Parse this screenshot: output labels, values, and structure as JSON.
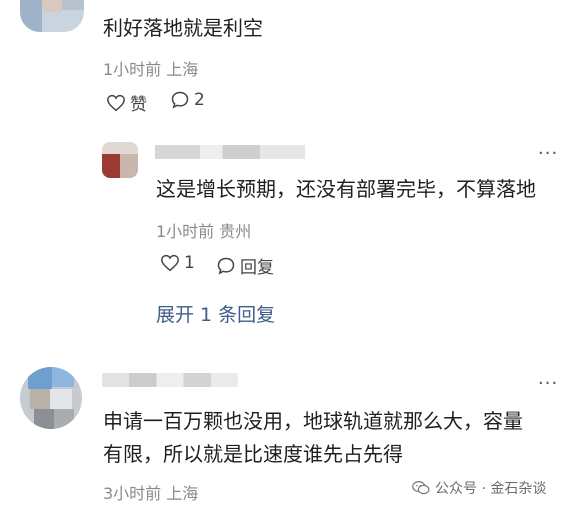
{
  "comments": [
    {
      "text": "利好落地就是利空",
      "meta": "1小时前 上海",
      "like_label": "赞",
      "reply_count": "2"
    },
    {
      "text": "这是增长预期，还没有部署完毕，不算落地",
      "meta": "1小时前 贵州",
      "like_count": "1",
      "reply_label": "回复",
      "expand_label": "展开 1 条回复"
    },
    {
      "text_line1": "申请一百万颗也没用，地球轨道就那么大，容量",
      "text_line2": "有限，所以就是比速度谁先占先得",
      "meta": "3小时前 上海"
    }
  ],
  "watermark": {
    "text": "公众号 · 金石杂谈"
  },
  "icons": {
    "like": "heart-icon",
    "reply": "speech-bubble-icon",
    "more": "more-dots-icon",
    "watermark": "wechat-icon"
  }
}
